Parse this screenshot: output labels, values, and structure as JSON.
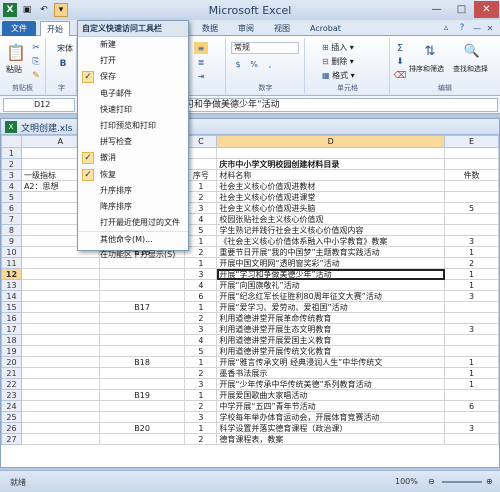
{
  "app": {
    "title": "Microsoft Excel"
  },
  "tabs": {
    "file": "文件",
    "home": "开始",
    "data": "数据",
    "review": "审阅",
    "view": "视图",
    "acrobat": "Acrobat"
  },
  "ribbon": {
    "paste": "粘贴",
    "clipboard": "剪贴板",
    "font_name": "宋体",
    "font_group": "字",
    "number_format": "常规",
    "number_group": "数字",
    "insert": "插入",
    "delete": "删除",
    "format": "格式",
    "cells_group": "单元格",
    "sort_filter": "排序和筛选",
    "find_select": "查找和选择",
    "editing_group": "编辑",
    "sigma": "Σ"
  },
  "formula": {
    "namebox": "D12",
    "fx": "fx",
    "content": "习和争做美德少年”活动"
  },
  "workbook": {
    "title": "文明创建.xls"
  },
  "menu": {
    "header": "自定义快速访问工具栏",
    "items": [
      {
        "label": "新建",
        "checked": false
      },
      {
        "label": "打开",
        "checked": false
      },
      {
        "label": "保存",
        "checked": true
      },
      {
        "label": "电子邮件",
        "checked": false
      },
      {
        "label": "快速打印",
        "checked": false
      },
      {
        "label": "打印预览和打印",
        "checked": false
      },
      {
        "label": "拼写检查",
        "checked": false
      },
      {
        "label": "撤消",
        "checked": true
      },
      {
        "label": "恢复",
        "checked": true
      },
      {
        "label": "升序排序",
        "checked": false
      },
      {
        "label": "降序排序",
        "checked": false
      },
      {
        "label": "打开最近使用过的文件",
        "checked": false
      },
      {
        "label": "其他命令(M)...",
        "checked": false
      },
      {
        "label": "在功能区下方显示(S)",
        "checked": false
      }
    ]
  },
  "sheet": {
    "col_headers": [
      "A",
      "B",
      "C",
      "D",
      "E"
    ],
    "rows": [
      {
        "n": "1",
        "a": "",
        "b": "",
        "c": "",
        "d": "",
        "e": ""
      },
      {
        "n": "2",
        "a": "",
        "b": "",
        "c": "",
        "d": "庆市中小学文明校园创建材料目录",
        "e": ""
      },
      {
        "n": "3",
        "a": "一级指标",
        "b": "",
        "c": "序号",
        "d": "材料名称",
        "e": "件数"
      },
      {
        "n": "4",
        "a": "A2：思想",
        "b": "",
        "c": "1",
        "d": "社会主义核心价值观进教材",
        "e": ""
      },
      {
        "n": "5",
        "a": "",
        "b": "",
        "c": "2",
        "d": "社会主义核心价值观进课堂",
        "e": ""
      },
      {
        "n": "6",
        "a": "",
        "b": "",
        "c": "3",
        "d": "社会主义核心价值观进头脑",
        "e": "5"
      },
      {
        "n": "7",
        "a": "",
        "b": "",
        "c": "4",
        "d": "校园张贴社会主义核心价值观",
        "e": ""
      },
      {
        "n": "8",
        "a": "",
        "b": "",
        "c": "5",
        "d": "学生熟记并践行社会主义核心价值观内容",
        "e": ""
      },
      {
        "n": "9",
        "a": "",
        "b": "",
        "c": "1",
        "d": "《社会主义核心价值体系融入中小学教育》教案",
        "e": "3"
      },
      {
        "n": "10",
        "a": "",
        "b": "B16",
        "c": "2",
        "d": "重要节日开展“我的中国梦”主题教育实践活动",
        "e": "1"
      },
      {
        "n": "11",
        "a": "",
        "b": "",
        "c": "1",
        "d": "开展中国文明网“透明窗奖彩”活动",
        "e": "2"
      },
      {
        "n": "12",
        "a": "",
        "b": "",
        "c": "3",
        "d": "开展“学习和争做美德少年”活动",
        "e": "1"
      },
      {
        "n": "13",
        "a": "",
        "b": "",
        "c": "4",
        "d": "开展“向国旗敬礼”活动",
        "e": "1"
      },
      {
        "n": "14",
        "a": "",
        "b": "",
        "c": "6",
        "d": "开展“纪念红军长征胜利80周年征文大赛”活动",
        "e": "3"
      },
      {
        "n": "15",
        "a": "",
        "b": "B17",
        "c": "1",
        "d": "开展“爱学习、爱劳动、爱祖国”活动",
        "e": ""
      },
      {
        "n": "16",
        "a": "",
        "b": "",
        "c": "2",
        "d": "利用道德讲堂开展革命传统教育",
        "e": ""
      },
      {
        "n": "17",
        "a": "",
        "b": "",
        "c": "3",
        "d": "利用道德讲堂开展生态文明教育",
        "e": "3"
      },
      {
        "n": "18",
        "a": "",
        "b": "",
        "c": "4",
        "d": "利用道德讲堂开展爱国主义教育",
        "e": ""
      },
      {
        "n": "19",
        "a": "",
        "b": "",
        "c": "5",
        "d": "利用道德讲堂开展传统文化教育",
        "e": ""
      },
      {
        "n": "20",
        "a": "",
        "b": "B18",
        "c": "1",
        "d": "开展“雅言传承文明  经典浸润人生”中华传统文",
        "e": "1"
      },
      {
        "n": "21",
        "a": "",
        "b": "",
        "c": "2",
        "d": "墨香书法展示",
        "e": "1"
      },
      {
        "n": "22",
        "a": "",
        "b": "",
        "c": "3",
        "d": "开展“少年传承中华传统美德”系列教育活动",
        "e": "1"
      },
      {
        "n": "23",
        "a": "",
        "b": "B19",
        "c": "1",
        "d": "开展爱国歌曲大家唱活动",
        "e": ""
      },
      {
        "n": "24",
        "a": "",
        "b": "",
        "c": "2",
        "d": "中学开展“五四”青年节活动",
        "e": "6"
      },
      {
        "n": "25",
        "a": "",
        "b": "",
        "c": "3",
        "d": "学校每年举办体育运动会，开展体育竞赛活动",
        "e": ""
      },
      {
        "n": "26",
        "a": "",
        "b": "B20",
        "c": "1",
        "d": "科学设置并落实德育课程（政治课）",
        "e": "3"
      },
      {
        "n": "27",
        "a": "",
        "b": "",
        "c": "2",
        "d": "德育课程表，教案",
        "e": ""
      }
    ]
  },
  "status": {
    "text": "就绪",
    "zoom": "100%"
  }
}
